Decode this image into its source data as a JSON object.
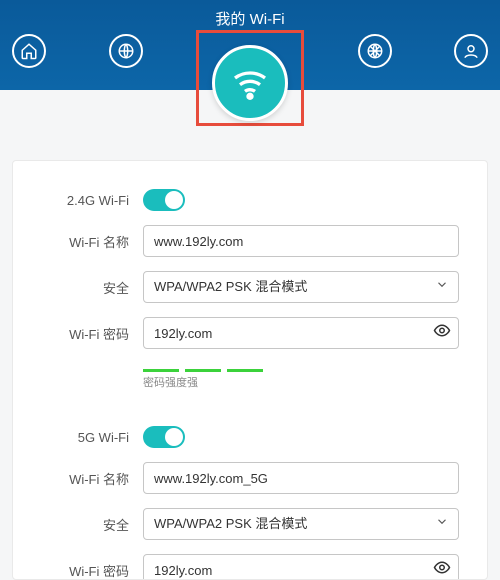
{
  "header": {
    "title": "我的 Wi-Fi"
  },
  "wifi24": {
    "toggle_label": "2.4G Wi-Fi",
    "enabled": true,
    "name_label": "Wi-Fi 名称",
    "name_value": "www.192ly.com",
    "security_label": "安全",
    "security_value": "WPA/WPA2 PSK 混合模式",
    "password_label": "Wi-Fi 密码",
    "password_value": "192ly.com",
    "strength_label": "密码强度强"
  },
  "wifi5": {
    "toggle_label": "5G Wi-Fi",
    "enabled": true,
    "name_label": "Wi-Fi 名称",
    "name_value": "www.192ly.com_5G",
    "security_label": "安全",
    "security_value": "WPA/WPA2 PSK 混合模式",
    "password_label": "Wi-Fi 密码",
    "password_value": "192ly.com"
  }
}
